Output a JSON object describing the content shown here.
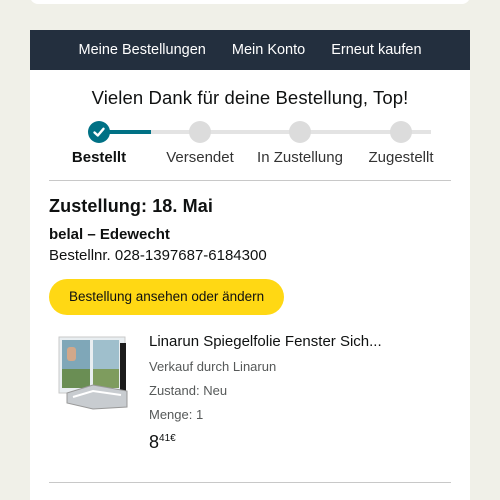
{
  "nav": {
    "items": [
      "Meine Bestellungen",
      "Mein Konto",
      "Erneut kaufen"
    ]
  },
  "thanks_message": "Vielen Dank für deine Bestellung, Top!",
  "tracker": {
    "steps": [
      "Bestellt",
      "Versendet",
      "In Zustellung",
      "Zugestellt"
    ],
    "current_step": "Bestellt",
    "accent_color": "#007185"
  },
  "delivery": {
    "title": "Zustellung: 18. Mai",
    "recipient": "belal – Edewecht",
    "order_number": "Bestellnr. 028-1397687-6184300"
  },
  "view_order_button": "Bestellung ansehen oder ändern",
  "product": {
    "title": "Linarun Spiegelfolie Fenster Sich...",
    "seller": "Verkauf durch Linarun",
    "condition": "Zustand: Neu",
    "quantity": "Menge: 1",
    "price_whole": "8",
    "price_fraction": "41",
    "price_currency": "€"
  },
  "colors": {
    "nav_bg": "#232f3e",
    "button_yellow": "#ffd814",
    "page_bg": "#f0f0e8"
  }
}
